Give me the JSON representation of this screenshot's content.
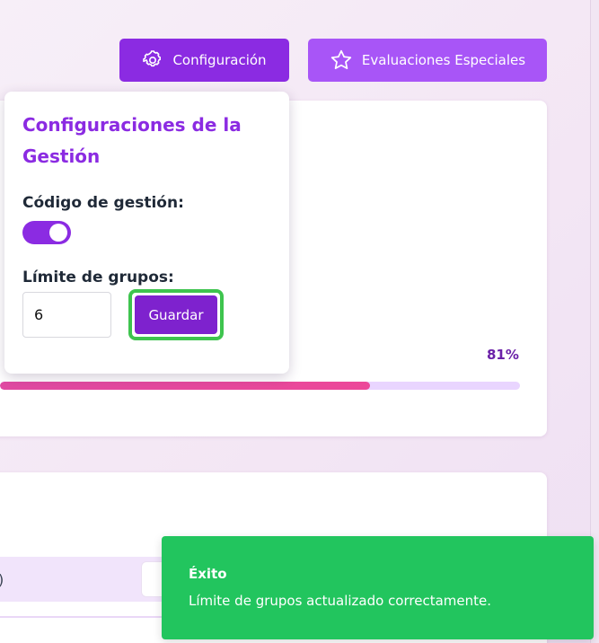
{
  "header": {
    "config_button_label": "Configuración",
    "special_button_label": "Evaluaciones Especiales",
    "config_icon": "gear-icon",
    "special_icon": "star-icon"
  },
  "progress": {
    "percent_label": "81%",
    "value": 0.81
  },
  "popover": {
    "title": "Configuraciones de la Gestión",
    "code_label": "Código de gestión:",
    "code_toggle_on": true,
    "limit_label": "Límite de grupos:",
    "limit_value": "6",
    "save_label": "Guardar"
  },
  "lower_card": {
    "partial_text": ")"
  },
  "toast": {
    "title": "Éxito",
    "message": "Límite de grupos actualizado correctamente."
  },
  "colors": {
    "primary": "#8b2be2",
    "secondary": "#a855f7",
    "success": "#22c55e",
    "highlight": "#3ec44e",
    "progress_fill": "#e04aa2"
  }
}
